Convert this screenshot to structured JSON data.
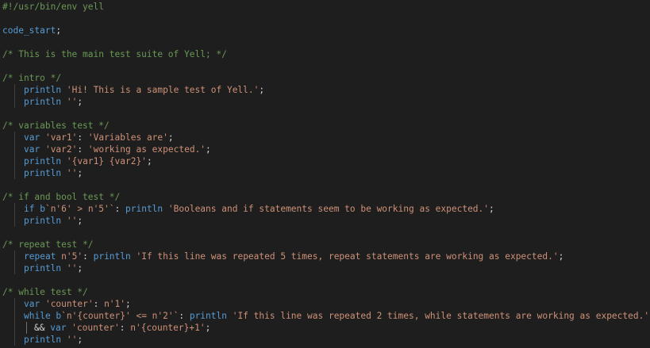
{
  "colors": {
    "background": "#1e1e1e",
    "comment": "#6a9955",
    "keyword": "#569cd6",
    "string": "#ce9178",
    "plain": "#d4d4d4"
  },
  "lines": [
    {
      "indent": 0,
      "tokens": [
        {
          "t": "comment",
          "v": "#!/usr/bin/env yell"
        }
      ]
    },
    {
      "indent": 0,
      "tokens": []
    },
    {
      "indent": 0,
      "tokens": [
        {
          "t": "kw",
          "v": "code_start"
        },
        {
          "t": "plain",
          "v": ";"
        }
      ]
    },
    {
      "indent": 0,
      "tokens": []
    },
    {
      "indent": 0,
      "tokens": [
        {
          "t": "comment",
          "v": "/* This is the main test suite of Yell; */"
        }
      ]
    },
    {
      "indent": 0,
      "tokens": []
    },
    {
      "indent": 0,
      "tokens": [
        {
          "t": "comment",
          "v": "/* intro */"
        }
      ]
    },
    {
      "indent": 1,
      "tokens": [
        {
          "t": "kw",
          "v": "println "
        },
        {
          "t": "str",
          "v": "'Hi! This is a sample test of Yell.'"
        },
        {
          "t": "plain",
          "v": ";"
        }
      ]
    },
    {
      "indent": 1,
      "tokens": [
        {
          "t": "kw",
          "v": "println "
        },
        {
          "t": "str",
          "v": "''"
        },
        {
          "t": "plain",
          "v": ";"
        }
      ]
    },
    {
      "indent": 0,
      "tokens": []
    },
    {
      "indent": 0,
      "tokens": [
        {
          "t": "comment",
          "v": "/* variables test */"
        }
      ]
    },
    {
      "indent": 1,
      "tokens": [
        {
          "t": "kw",
          "v": "var "
        },
        {
          "t": "str",
          "v": "'var1'"
        },
        {
          "t": "plain",
          "v": ": "
        },
        {
          "t": "str",
          "v": "'Variables are'"
        },
        {
          "t": "plain",
          "v": ";"
        }
      ]
    },
    {
      "indent": 1,
      "tokens": [
        {
          "t": "kw",
          "v": "var "
        },
        {
          "t": "str",
          "v": "'var2'"
        },
        {
          "t": "plain",
          "v": ": "
        },
        {
          "t": "str",
          "v": "'working as expected.'"
        },
        {
          "t": "plain",
          "v": ";"
        }
      ]
    },
    {
      "indent": 1,
      "tokens": [
        {
          "t": "kw",
          "v": "println "
        },
        {
          "t": "str",
          "v": "'{var1} {var2}'"
        },
        {
          "t": "plain",
          "v": ";"
        }
      ]
    },
    {
      "indent": 1,
      "tokens": [
        {
          "t": "kw",
          "v": "println "
        },
        {
          "t": "str",
          "v": "''"
        },
        {
          "t": "plain",
          "v": ";"
        }
      ]
    },
    {
      "indent": 0,
      "tokens": []
    },
    {
      "indent": 0,
      "tokens": [
        {
          "t": "comment",
          "v": "/* if and bool test */"
        }
      ]
    },
    {
      "indent": 1,
      "tokens": [
        {
          "t": "kw",
          "v": "if b"
        },
        {
          "t": "str",
          "v": "`n'6' > n'5'`"
        },
        {
          "t": "plain",
          "v": ": "
        },
        {
          "t": "kw",
          "v": "println "
        },
        {
          "t": "str",
          "v": "'Booleans and if statements seem to be working as expected.'"
        },
        {
          "t": "plain",
          "v": ";"
        }
      ]
    },
    {
      "indent": 1,
      "tokens": [
        {
          "t": "kw",
          "v": "println "
        },
        {
          "t": "str",
          "v": "''"
        },
        {
          "t": "plain",
          "v": ";"
        }
      ]
    },
    {
      "indent": 0,
      "tokens": []
    },
    {
      "indent": 0,
      "tokens": [
        {
          "t": "comment",
          "v": "/* repeat test */"
        }
      ]
    },
    {
      "indent": 1,
      "tokens": [
        {
          "t": "kw",
          "v": "repeat "
        },
        {
          "t": "str",
          "v": "n'5'"
        },
        {
          "t": "plain",
          "v": ": "
        },
        {
          "t": "kw",
          "v": "println "
        },
        {
          "t": "str",
          "v": "'If this line was repeated 5 times, repeat statements are working as expected.'"
        },
        {
          "t": "plain",
          "v": ";"
        }
      ]
    },
    {
      "indent": 1,
      "tokens": [
        {
          "t": "kw",
          "v": "println "
        },
        {
          "t": "str",
          "v": "''"
        },
        {
          "t": "plain",
          "v": ";"
        }
      ]
    },
    {
      "indent": 0,
      "tokens": []
    },
    {
      "indent": 0,
      "tokens": [
        {
          "t": "comment",
          "v": "/* while test */"
        }
      ]
    },
    {
      "indent": 1,
      "tokens": [
        {
          "t": "kw",
          "v": "var "
        },
        {
          "t": "str",
          "v": "'counter'"
        },
        {
          "t": "plain",
          "v": ": "
        },
        {
          "t": "str",
          "v": "n'1'"
        },
        {
          "t": "plain",
          "v": ";"
        }
      ]
    },
    {
      "indent": 1,
      "tokens": [
        {
          "t": "kw",
          "v": "while b"
        },
        {
          "t": "str",
          "v": "`n'{counter}' <= n'2'`"
        },
        {
          "t": "plain",
          "v": ": "
        },
        {
          "t": "kw",
          "v": "println "
        },
        {
          "t": "str",
          "v": "'If this line was repeated 2 times, while statements are working as expected.'"
        }
      ]
    },
    {
      "indent": 2,
      "tokens": [
        {
          "t": "plain",
          "v": "&& "
        },
        {
          "t": "kw",
          "v": "var "
        },
        {
          "t": "str",
          "v": "'counter'"
        },
        {
          "t": "plain",
          "v": ": "
        },
        {
          "t": "str",
          "v": "n'{counter}+1'"
        },
        {
          "t": "plain",
          "v": ";"
        }
      ]
    },
    {
      "indent": 1,
      "tokens": [
        {
          "t": "kw",
          "v": "println "
        },
        {
          "t": "str",
          "v": "''"
        },
        {
          "t": "plain",
          "v": ";"
        }
      ]
    }
  ]
}
